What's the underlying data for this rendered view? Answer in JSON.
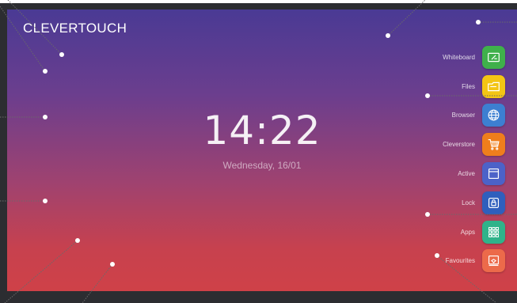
{
  "screen": {
    "brand": "CLEVERTOUCH",
    "clock": "14:22",
    "date": "Wednesday, 16/01"
  },
  "menu": {
    "items": [
      {
        "label": "Whiteboard",
        "color": "#3fb04b",
        "icon": "whiteboard-icon"
      },
      {
        "label": "Files",
        "color": "#f3c514",
        "icon": "folder-icon"
      },
      {
        "label": "Browser",
        "color": "#3d7fd1",
        "icon": "globe-icon"
      },
      {
        "label": "Cleverstore",
        "color": "#ef7e1c",
        "icon": "cart-icon"
      },
      {
        "label": "Active",
        "color": "#4c62c8",
        "icon": "window-icon"
      },
      {
        "label": "Lock",
        "color": "#2f5fbd",
        "icon": "lock-icon"
      },
      {
        "label": "Apps",
        "color": "#2fb38a",
        "icon": "grid-icon"
      },
      {
        "label": "Favourites",
        "color": "#ec6a4a",
        "icon": "favourites-icon"
      }
    ]
  }
}
